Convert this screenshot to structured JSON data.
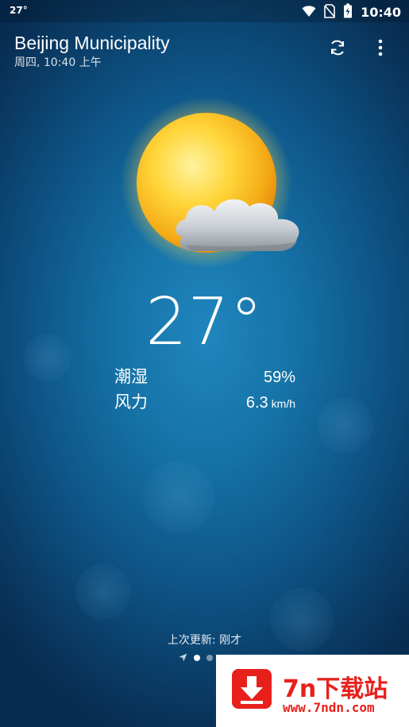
{
  "status_bar": {
    "temp": "27°",
    "time": "10:40",
    "icons": [
      "wifi-icon",
      "no-sim-icon",
      "battery-charging-icon"
    ]
  },
  "header": {
    "city": "Beijing Municipality",
    "date": "周四, 10:40 上午",
    "refresh_icon": "refresh-icon",
    "menu_icon": "more-vert-icon"
  },
  "weather": {
    "condition_icon": "partly-sunny-icon",
    "temperature": "27°",
    "humidity_label": "潮湿",
    "humidity_value": "59%",
    "wind_label": "风力",
    "wind_value": "6.3",
    "wind_unit": "km/h"
  },
  "footer": {
    "updated": "上次更新:  刚才",
    "page_indicator": {
      "count": 3,
      "active": 1,
      "location_icon": "location-arrow-icon"
    }
  },
  "watermark": {
    "title": "7n下载站",
    "url": "www.7ndn.com",
    "icon": "download-arrow-icon",
    "color": "#e8201c"
  },
  "colors": {
    "background_top": "#0a3c66",
    "background_center": "#1f86bd"
  }
}
